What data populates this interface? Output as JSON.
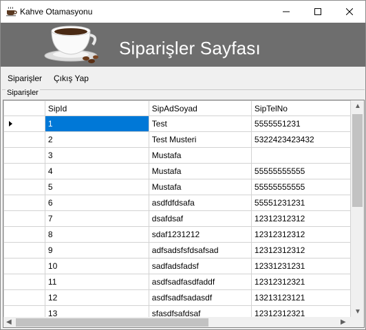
{
  "window": {
    "title": "Kahve Otamasyonu",
    "icon": "coffee-cup-icon"
  },
  "header": {
    "title": "Siparişler Sayfası",
    "banner_icon": "coffee-cup-beans-icon"
  },
  "menu": {
    "items": [
      {
        "label": "Siparişler"
      },
      {
        "label": "Çıkış Yap"
      }
    ]
  },
  "group": {
    "label": "Siparişler"
  },
  "grid": {
    "columns": [
      "SipId",
      "SipAdSoyad",
      "SipTelNo"
    ],
    "selected_row": 0,
    "rows": [
      {
        "SipId": "1",
        "SipAdSoyad": "Test",
        "SipTelNo": "5555551231"
      },
      {
        "SipId": "2",
        "SipAdSoyad": "Test Musteri",
        "SipTelNo": "5322423423432"
      },
      {
        "SipId": "3",
        "SipAdSoyad": "Mustafa",
        "SipTelNo": ""
      },
      {
        "SipId": "4",
        "SipAdSoyad": "Mustafa",
        "SipTelNo": "55555555555"
      },
      {
        "SipId": "5",
        "SipAdSoyad": "Mustafa",
        "SipTelNo": "55555555555"
      },
      {
        "SipId": "6",
        "SipAdSoyad": "asdfdfdsafa",
        "SipTelNo": "55551231231"
      },
      {
        "SipId": "7",
        "SipAdSoyad": "dsafdsaf",
        "SipTelNo": "12312312312"
      },
      {
        "SipId": "8",
        "SipAdSoyad": "sdaf1231212",
        "SipTelNo": "12312312312"
      },
      {
        "SipId": "9",
        "SipAdSoyad": "adfsadsfsfdsafsad",
        "SipTelNo": "12312312312"
      },
      {
        "SipId": "10",
        "SipAdSoyad": "sadfadsfadsf",
        "SipTelNo": "12331231231"
      },
      {
        "SipId": "11",
        "SipAdSoyad": "asdfsadfasdfaddf",
        "SipTelNo": "12312312321"
      },
      {
        "SipId": "12",
        "SipAdSoyad": "asdfsadfsadasdf",
        "SipTelNo": "13213123121"
      },
      {
        "SipId": "13",
        "SipAdSoyad": "sfasdfsafdsaf",
        "SipTelNo": "12312312321"
      }
    ]
  },
  "colors": {
    "header_bg": "#6e6e6e",
    "selection": "#0078d7"
  }
}
